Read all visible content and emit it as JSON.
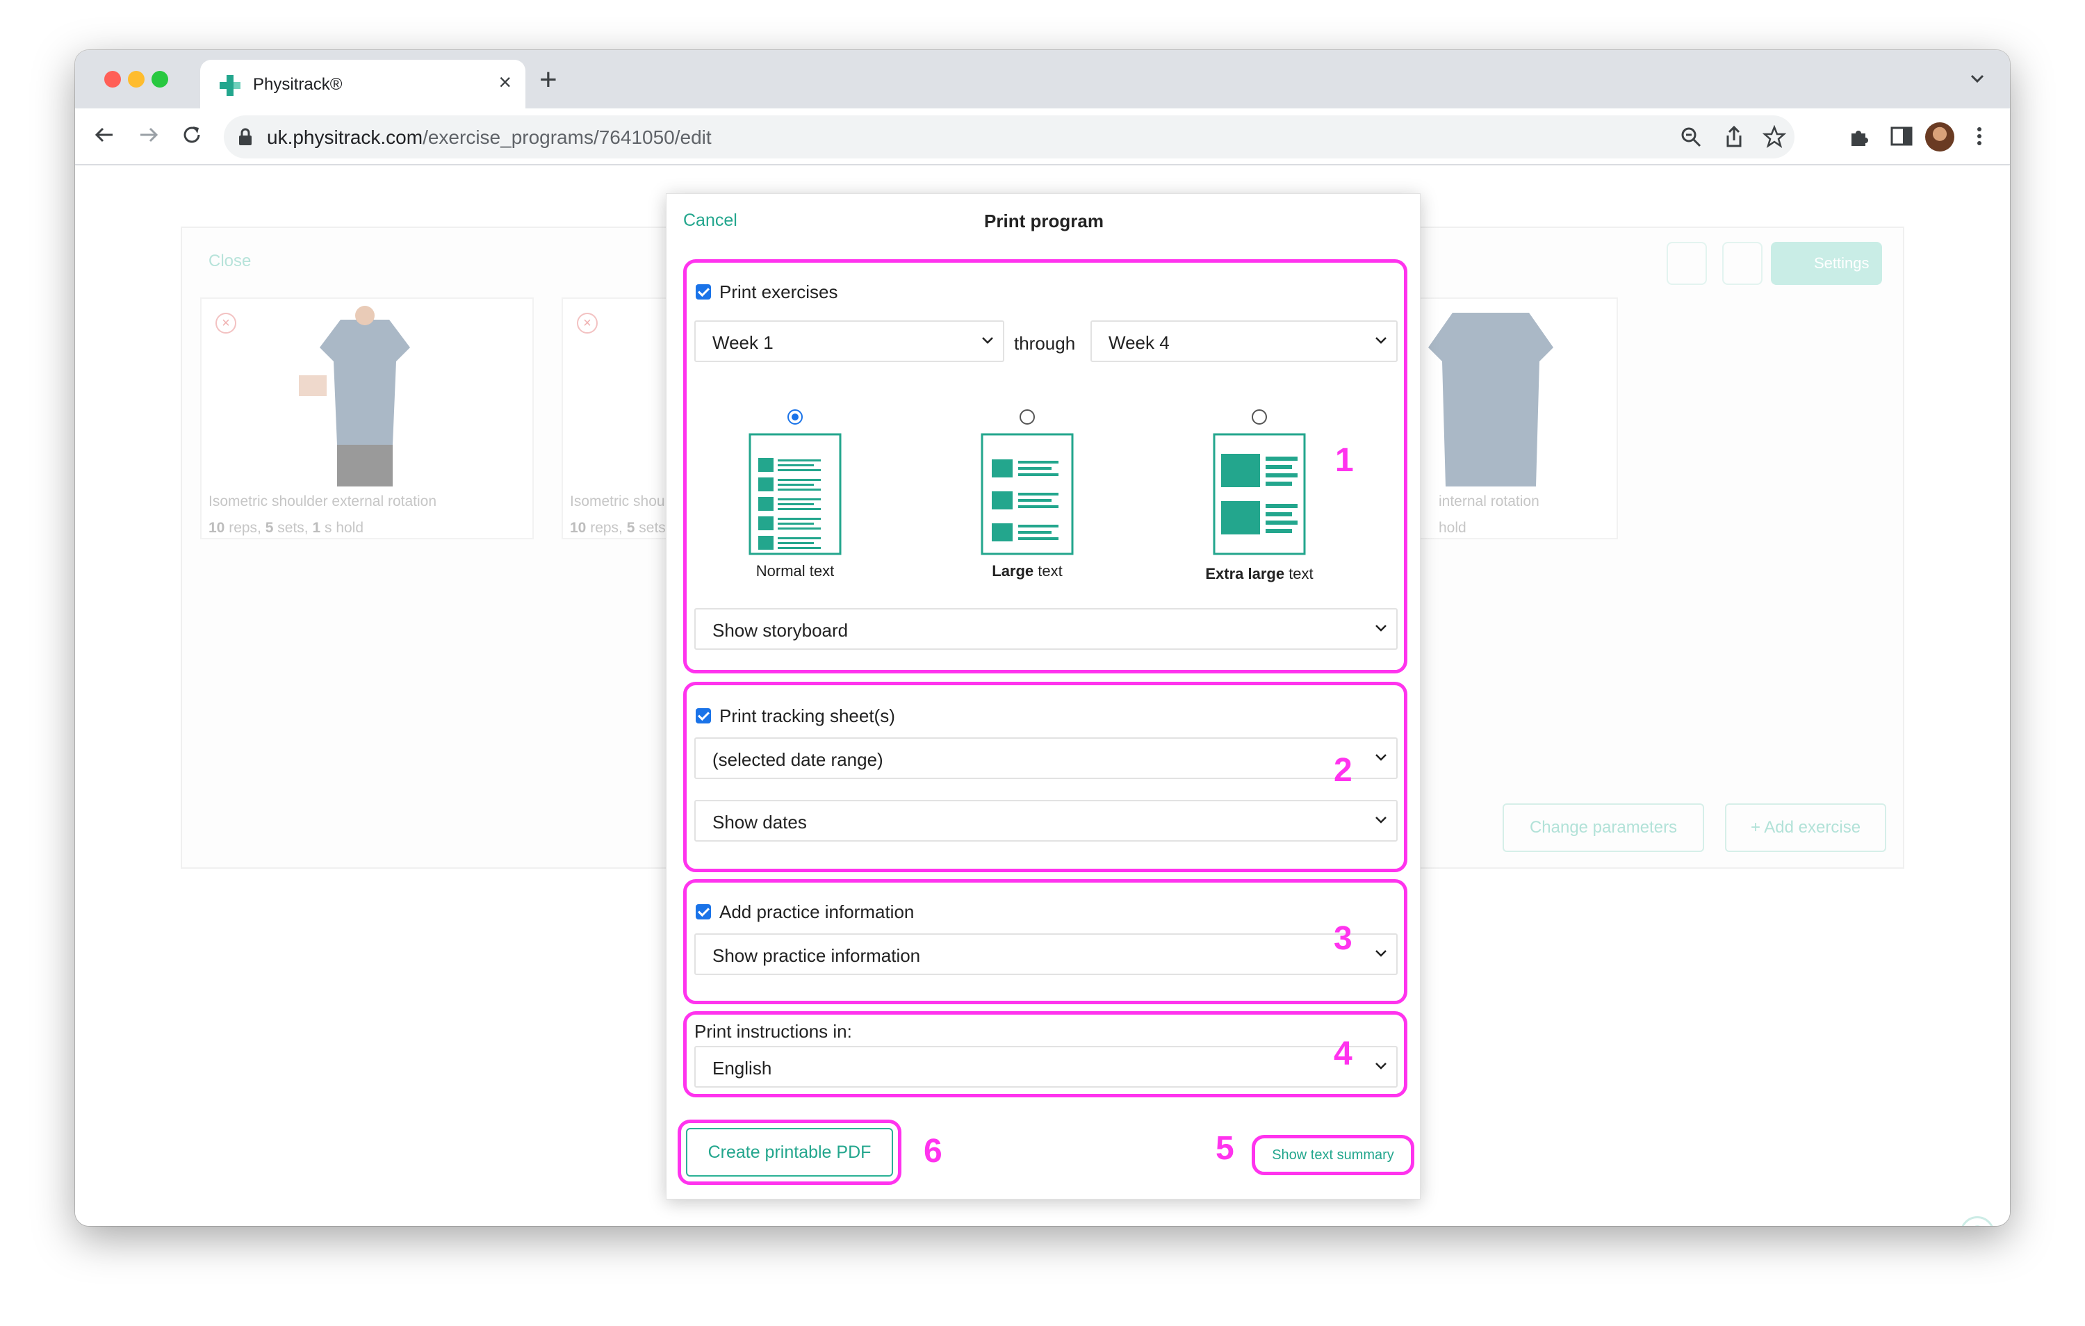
{
  "browser": {
    "tab_title": "Physitrack®",
    "url_host": "uk.physitrack.com",
    "url_path": "/exercise_programs/7641050/edit"
  },
  "background": {
    "close_label": "Close",
    "settings_label": "Settings",
    "exercises": [
      {
        "name": "Isometric shoulder external rotation",
        "reps": "10",
        "sets": "5",
        "hold": "1"
      },
      {
        "name": "Isometric shou",
        "reps": "10",
        "sets": "5",
        "hold": ""
      },
      {
        "name": "internal rotation",
        "reps": "",
        "sets": "",
        "hold": ""
      }
    ],
    "dose_parts": {
      "reps": "reps,",
      "sets": "sets,",
      "hold": "s hold",
      "hold_partial": "hold"
    },
    "change_parameters_label": "Change parameters",
    "add_exercise_label": "+ Add exercise",
    "help_label": "?"
  },
  "modal": {
    "cancel_label": "Cancel",
    "title": "Print program",
    "print_exercises": {
      "label": "Print exercises",
      "from_week": "Week 1",
      "through_label": "through",
      "to_week": "Week 4",
      "sizes": [
        {
          "bold": "",
          "rest": "Normal text",
          "selected": true
        },
        {
          "bold": "Large",
          "rest": " text",
          "selected": false
        },
        {
          "bold": "Extra large",
          "rest": " text",
          "selected": false
        }
      ],
      "storyboard_option": "Show storyboard"
    },
    "tracking": {
      "label": "Print tracking sheet(s)",
      "range_option": "(selected date range)",
      "dates_option": "Show dates"
    },
    "practice": {
      "label": "Add practice information",
      "option": "Show practice information"
    },
    "language": {
      "label": "Print instructions in:",
      "option": "English"
    },
    "create_pdf_label": "Create printable PDF",
    "text_summary_label": "Show text summary"
  },
  "annotations": [
    "1",
    "2",
    "3",
    "4",
    "5",
    "6"
  ],
  "colors": {
    "accent": "#23a68d",
    "annotation": "#ff33ee",
    "checkbox": "#1a73e8"
  }
}
